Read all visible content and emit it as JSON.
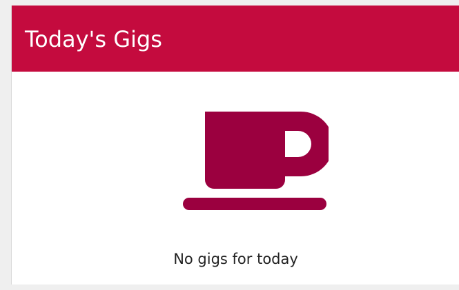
{
  "panel": {
    "title": "Today's Gigs",
    "header_color": "#c40b3e"
  },
  "empty_state": {
    "icon": "coffee-cup-icon",
    "icon_color": "#9b003f",
    "message": "No gigs for today"
  }
}
